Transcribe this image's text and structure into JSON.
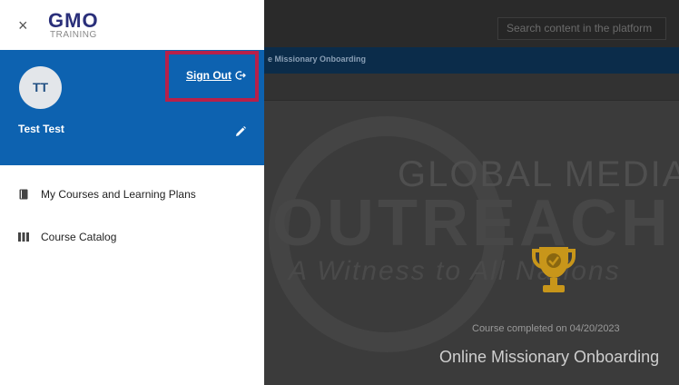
{
  "background": {
    "search": {
      "placeholder": "Search content in the platform"
    },
    "breadcrumb": "e Missionary Onboarding",
    "watermark": {
      "global": "GLOBAL MEDIA",
      "outreach": "OUTREACH",
      "tagline": "A Witness to All Nations"
    },
    "trophy_icon": "trophy-icon",
    "completed_text": "Course completed on 04/20/2023",
    "course_title": "Online Missionary Onboarding"
  },
  "drawer": {
    "close_icon": "close-icon",
    "logo": {
      "main": "GMO",
      "sub": "TRAINING"
    },
    "profile": {
      "initials": "TT",
      "name": "Test Test",
      "sign_out_label": "Sign Out",
      "sign_out_icon": "sign-out-icon",
      "edit_icon": "pencil-icon"
    },
    "menu": [
      {
        "label": "My Courses and Learning Plans",
        "icon": "book-icon"
      },
      {
        "label": "Course Catalog",
        "icon": "catalog-icon"
      }
    ]
  },
  "colors": {
    "profile_bg": "#0d62b0",
    "highlight": "#b7204a",
    "logo": "#2a2f7a",
    "trophy": "#c8961a"
  }
}
